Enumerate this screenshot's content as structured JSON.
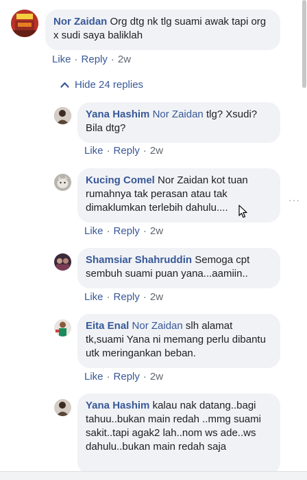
{
  "comment": {
    "author": "Nor Zaidan",
    "text": "Org dtg nk tlg suami awak tapi org x sudi saya baliklah",
    "like": "Like",
    "reply": "Reply",
    "time": "2w"
  },
  "hide_replies_label": "Hide 24 replies",
  "replies": [
    {
      "author": "Yana Hashim",
      "tag": "Nor Zaidan",
      "text": "tlg? Xsudi? Bila dtg?",
      "like": "Like",
      "reply": "Reply",
      "time": "2w"
    },
    {
      "author": "Kucing Comel",
      "tag": "",
      "text": "Nor Zaidan kot tuan rumahnya tak perasan atau tak dimaklumkan terlebih dahulu....",
      "like": "Like",
      "reply": "Reply",
      "time": "2w"
    },
    {
      "author": "Shamsiar Shahruddin",
      "tag": "",
      "text": "Semoga cpt sembuh suami puan yana...aamiin..",
      "like": "Like",
      "reply": "Reply",
      "time": "2w"
    },
    {
      "author": "Eita Enal",
      "tag": "Nor Zaidan",
      "text": "slh alamat tk,suami Yana ni memang perlu dibantu utk meringankan beban.",
      "like": "Like",
      "reply": "Reply",
      "time": "2w"
    },
    {
      "author": "Yana Hashim",
      "tag": "",
      "text": "kalau nak datang..bagi tahuu..bukan main redah ..mmg suami sakit..tapi agak2 lah..nom ws ade..ws dahulu..bukan main redah saja"
    }
  ],
  "more_options": "···"
}
